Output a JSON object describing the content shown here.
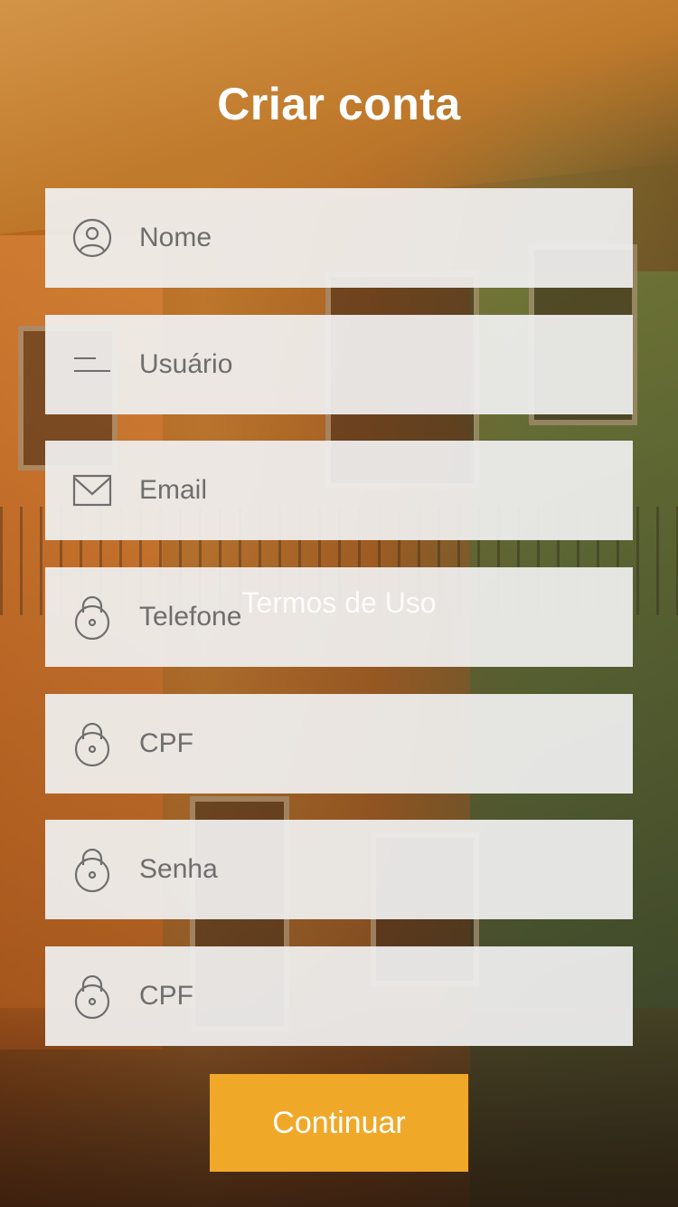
{
  "title": "Criar conta",
  "fields": [
    {
      "placeholder": "Nome",
      "icon": "user-circle-icon"
    },
    {
      "placeholder": "Usuário",
      "icon": "lines-icon"
    },
    {
      "placeholder": "Email",
      "icon": "envelope-icon"
    },
    {
      "placeholder": "Telefone",
      "icon": "lock-icon"
    },
    {
      "placeholder": "CPF",
      "icon": "lock-icon"
    },
    {
      "placeholder": "Senha",
      "icon": "lock-icon"
    },
    {
      "placeholder": "CPF",
      "icon": "lock-icon"
    }
  ],
  "terms_link": "Termos de Uso",
  "continue_label": "Continuar",
  "colors": {
    "accent": "#f0a829",
    "field_bg": "#f0f0f0",
    "icon": "#6e6e6e"
  }
}
